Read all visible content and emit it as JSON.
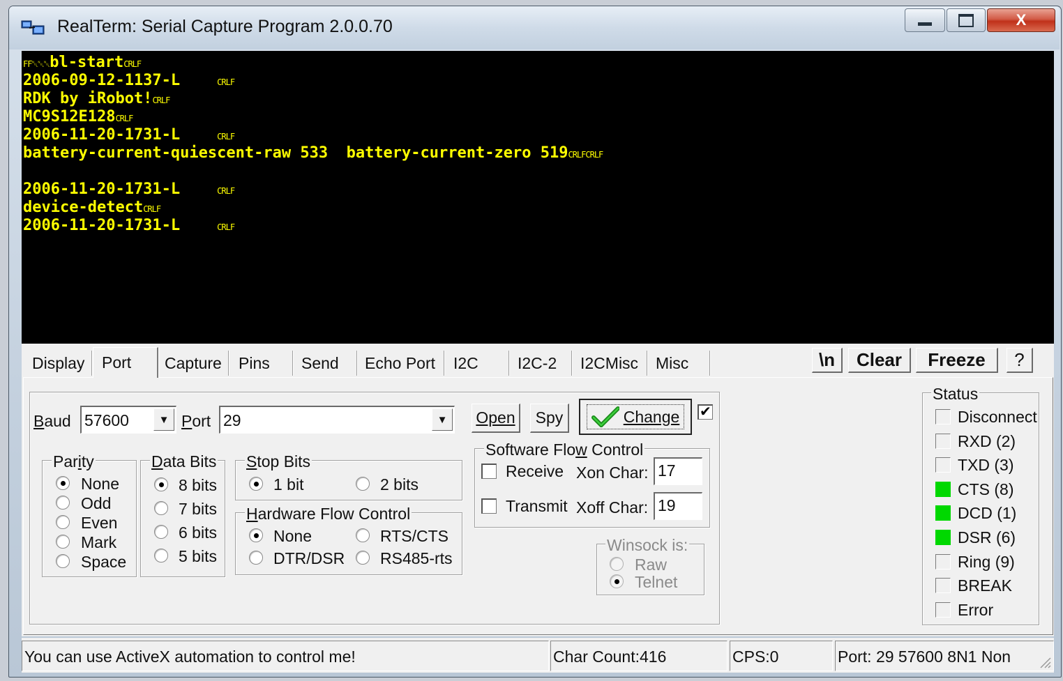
{
  "window": {
    "title": "RealTerm: Serial Capture Program 2.0.0.70",
    "controls": {
      "minimize": "–",
      "maximize": "□",
      "close": "X"
    }
  },
  "terminal": {
    "text_color": "#ffff00",
    "background": "#000000",
    "lines": [
      {
        "prefix_ctl": "FF␀␀␀",
        "text": "bl-start",
        "suffix_ctl": "CRLF"
      },
      {
        "prefix_ctl": "",
        "text": "2006-09-12-1137-L    ",
        "suffix_ctl": "CRLF"
      },
      {
        "prefix_ctl": "",
        "text": "RDK by iRobot!",
        "suffix_ctl": "CRLF"
      },
      {
        "prefix_ctl": "",
        "text": "MC9S12E128",
        "suffix_ctl": "CRLF"
      },
      {
        "prefix_ctl": "",
        "text": "2006-11-20-1731-L    ",
        "suffix_ctl": "CRLF"
      },
      {
        "prefix_ctl": "",
        "text": "battery-current-quiescent-raw 533  battery-current-zero 519",
        "suffix_ctl": "CRLFCRLF"
      },
      {
        "prefix_ctl": "",
        "text": "",
        "suffix_ctl": ""
      },
      {
        "prefix_ctl": "",
        "text": "2006-11-20-1731-L    ",
        "suffix_ctl": "CRLF"
      },
      {
        "prefix_ctl": "",
        "text": "device-detect",
        "suffix_ctl": "CRLF"
      },
      {
        "prefix_ctl": "",
        "text": "2006-11-20-1731-L    ",
        "suffix_ctl": "CRLF"
      }
    ]
  },
  "tabs": [
    "Display",
    "Port",
    "Capture",
    "Pins",
    "Send",
    "Echo Port",
    "I2C",
    "I2C-2",
    "I2CMisc",
    "Misc"
  ],
  "active_tab": "Port",
  "toolbar_buttons": {
    "newline": "\\n",
    "clear": "Clear",
    "freeze": "Freeze",
    "help": "?"
  },
  "port": {
    "baud_label": "Baud",
    "baud_value": "57600",
    "port_label": "Port",
    "port_value": "29",
    "open_button": "Open",
    "spy_button": "Spy",
    "change_button": "Change",
    "change_checked": true
  },
  "parity": {
    "label": "Parity",
    "options": [
      "None",
      "Odd",
      "Even",
      "Mark",
      "Space"
    ],
    "selected": "None"
  },
  "data_bits": {
    "label": "Data Bits",
    "options": [
      "8 bits",
      "7 bits",
      "6 bits",
      "5 bits"
    ],
    "selected": "8 bits"
  },
  "stop_bits": {
    "label": "Stop Bits",
    "options": [
      "1 bit",
      "2 bits"
    ],
    "selected": "1 bit"
  },
  "hw_flow": {
    "label": "Hardware Flow Control",
    "options": [
      "None",
      "RTS/CTS",
      "DTR/DSR",
      "RS485-rts"
    ],
    "selected": "None"
  },
  "sw_flow": {
    "label": "Software Flow Control",
    "receive_label": "Receive",
    "transmit_label": "Transmit",
    "xon_label": "Xon Char:",
    "xon_value": "17",
    "xoff_label": "Xoff Char:",
    "xoff_value": "19",
    "receive_checked": false,
    "transmit_checked": false
  },
  "winsock": {
    "label": "Winsock is:",
    "options": [
      "Raw",
      "Telnet"
    ],
    "selected": "Telnet"
  },
  "status": {
    "label": "Status",
    "items": [
      {
        "name": "Disconnect",
        "on": false
      },
      {
        "name": "RXD (2)",
        "on": false
      },
      {
        "name": "TXD (3)",
        "on": false
      },
      {
        "name": "CTS (8)",
        "on": true
      },
      {
        "name": "DCD (1)",
        "on": true
      },
      {
        "name": "DSR (6)",
        "on": true
      },
      {
        "name": "Ring (9)",
        "on": false
      },
      {
        "name": "BREAK",
        "on": false
      },
      {
        "name": "Error",
        "on": false
      }
    ],
    "led_on_color": "#00d800"
  },
  "statusbar": {
    "message": "You can use ActiveX automation to control me!",
    "char_count": "Char Count:416",
    "cps": "CPS:0",
    "port_info": "Port: 29 57600 8N1 Non"
  }
}
